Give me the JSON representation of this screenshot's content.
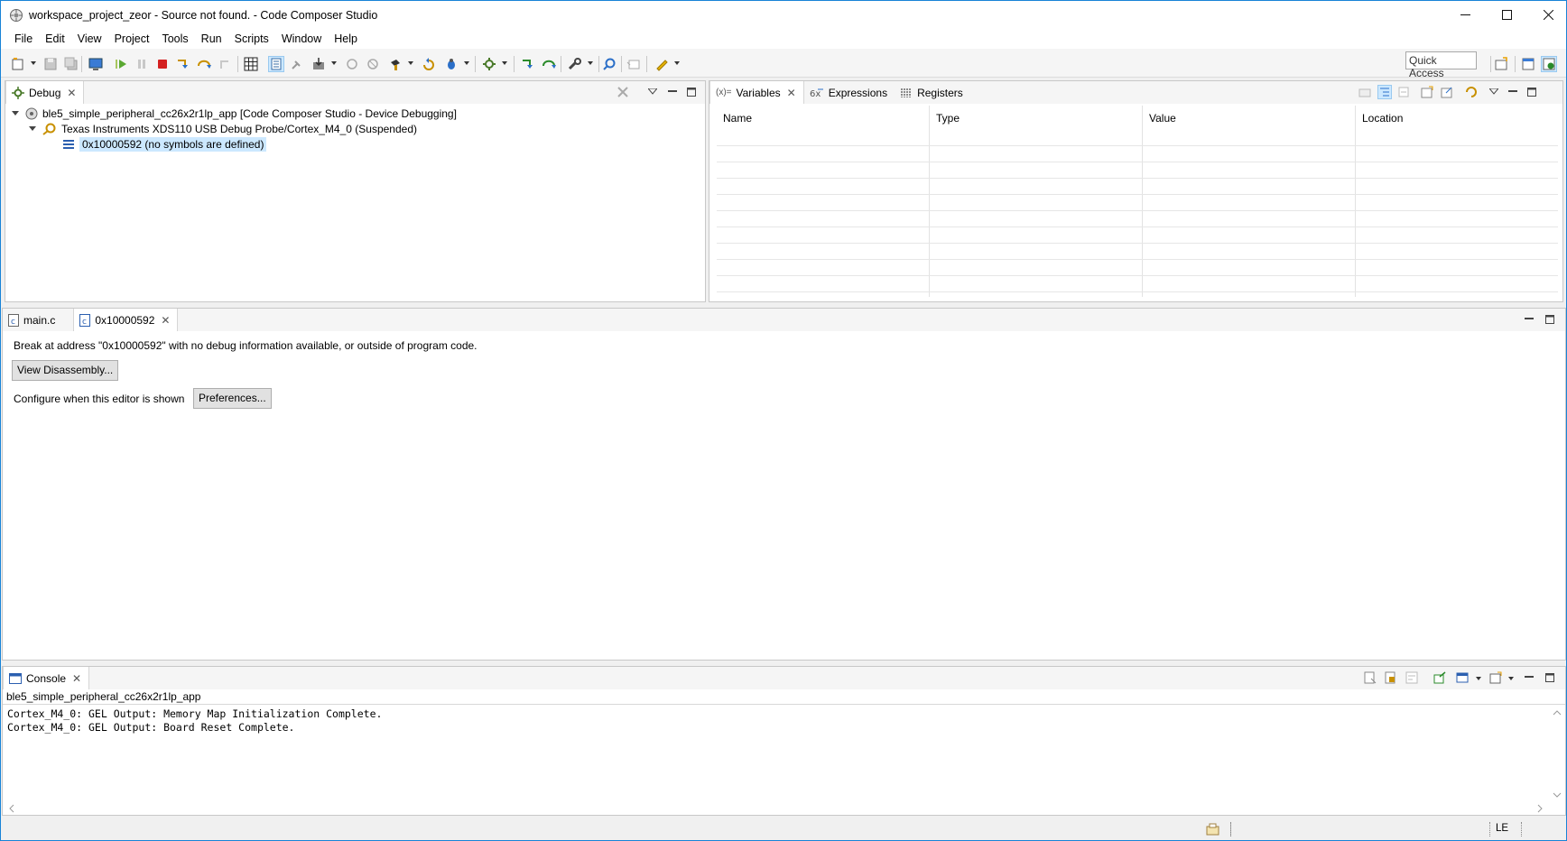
{
  "window": {
    "title": "workspace_project_zeor - Source not found. - Code Composer Studio",
    "minimize": "—",
    "maximize": "☐",
    "close": "✕"
  },
  "menubar": {
    "items": [
      "File",
      "Edit",
      "View",
      "Project",
      "Tools",
      "Run",
      "Scripts",
      "Window",
      "Help"
    ]
  },
  "toolbar": {
    "quick_access": "Quick Access"
  },
  "debug_view": {
    "tab_label": "Debug",
    "tree": {
      "session": "ble5_simple_peripheral_cc26x2r1lp_app [Code Composer Studio - Device Debugging]",
      "target": "Texas Instruments XDS110 USB Debug Probe/Cortex_M4_0 (Suspended)",
      "frame": "0x10000592  (no symbols are defined)"
    }
  },
  "variables_view": {
    "tabs": [
      {
        "label": "Variables",
        "icon": "variables-icon",
        "active": true
      },
      {
        "label": "Expressions",
        "icon": "expressions-icon",
        "active": false
      },
      {
        "label": "Registers",
        "icon": "registers-icon",
        "active": false
      }
    ],
    "columns": [
      "Name",
      "Type",
      "Value",
      "Location"
    ],
    "rows": []
  },
  "editor": {
    "tabs": [
      {
        "label": "main.c",
        "active": false
      },
      {
        "label": "0x10000592",
        "active": true
      }
    ],
    "message": "Break at address \"0x10000592\" with no debug information available, or outside of program code.",
    "view_disassembly_label": "View Disassembly...",
    "configure_label": "Configure when this editor is shown",
    "preferences_label": "Preferences..."
  },
  "console": {
    "tab_label": "Console",
    "process_name": "ble5_simple_peripheral_cc26x2r1lp_app",
    "lines": [
      "Cortex_M4_0: GEL Output: Memory Map Initialization Complete.",
      "Cortex_M4_0: GEL Output: Board Reset Complete."
    ]
  },
  "statusbar": {
    "endianness": "LE"
  },
  "colors": {
    "selection": "#cce8ff",
    "frame_border": "#1883d7",
    "panel_header": "#f5f5f5"
  }
}
